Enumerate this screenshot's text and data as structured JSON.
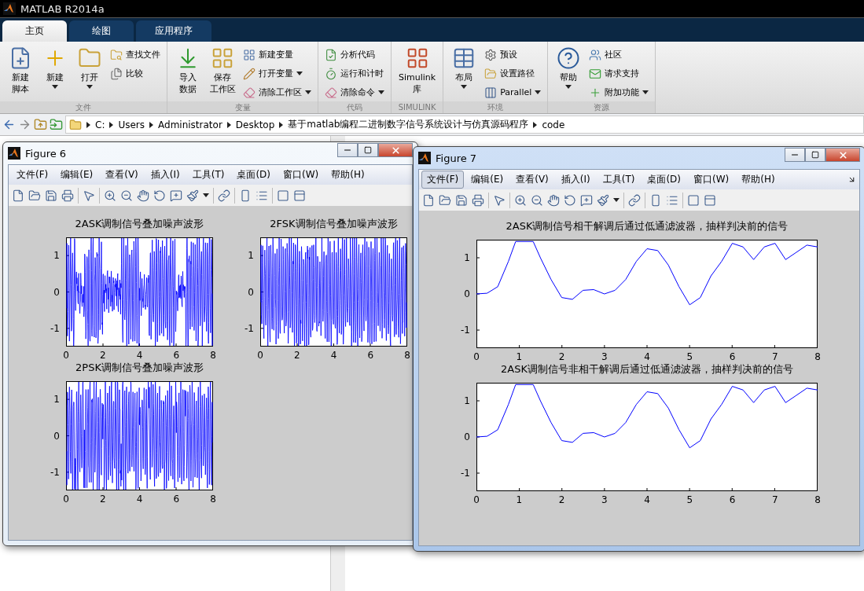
{
  "app": {
    "title": "MATLAB R2014a"
  },
  "tabs": [
    {
      "label": "主页",
      "selected": true
    },
    {
      "label": "绘图",
      "selected": false
    },
    {
      "label": "应用程序",
      "selected": false
    }
  ],
  "toolstrip": [
    {
      "label": "文件",
      "items": [
        {
          "kind": "large",
          "lines": [
            "新建",
            "脚本"
          ],
          "dropdown": false
        },
        {
          "kind": "large",
          "lines": [
            "新建"
          ],
          "dropdown": true
        },
        {
          "kind": "large",
          "lines": [
            "打开"
          ],
          "dropdown": true
        },
        {
          "kind": "small",
          "label": "查找文件",
          "dropdown": false
        },
        {
          "kind": "small",
          "label": "比较",
          "dropdown": false
        }
      ]
    },
    {
      "label": "变量",
      "items": [
        {
          "kind": "large",
          "lines": [
            "导入",
            "数据"
          ],
          "dropdown": false
        },
        {
          "kind": "large",
          "lines": [
            "保存",
            "工作区"
          ],
          "dropdown": false
        },
        {
          "kind": "small",
          "label": "新建变量",
          "dropdown": false
        },
        {
          "kind": "small",
          "label": "打开变量",
          "dropdown": true
        },
        {
          "kind": "small",
          "label": "清除工作区",
          "dropdown": true
        }
      ]
    },
    {
      "label": "代码",
      "items": [
        {
          "kind": "small",
          "label": "分析代码",
          "dropdown": false
        },
        {
          "kind": "small",
          "label": "运行和计时",
          "dropdown": false
        },
        {
          "kind": "small",
          "label": "清除命令",
          "dropdown": true
        }
      ]
    },
    {
      "label": "SIMULINK",
      "items": [
        {
          "kind": "large",
          "lines": [
            "Simulink",
            "库"
          ],
          "dropdown": false
        }
      ]
    },
    {
      "label": "环境",
      "items": [
        {
          "kind": "large",
          "lines": [
            "布局"
          ],
          "dropdown": true
        },
        {
          "kind": "small",
          "label": "预设",
          "dropdown": false
        },
        {
          "kind": "small",
          "label": "设置路径",
          "dropdown": false
        },
        {
          "kind": "small",
          "label": "Parallel",
          "dropdown": true
        }
      ]
    },
    {
      "label": "资源",
      "items": [
        {
          "kind": "large",
          "lines": [
            "帮助"
          ],
          "dropdown": true
        },
        {
          "kind": "small",
          "label": "社区",
          "dropdown": false
        },
        {
          "kind": "small",
          "label": "请求支持",
          "dropdown": false
        },
        {
          "kind": "small",
          "label": "附加功能",
          "dropdown": true
        }
      ]
    }
  ],
  "address_bar": {
    "path": [
      "C:",
      "Users",
      "Administrator",
      "Desktop",
      "基于matlab编程二进制数字信号系统设计与仿真源码程序",
      "code"
    ]
  },
  "figures": [
    {
      "title": "Figure 6",
      "active": false,
      "menu": [
        {
          "label": "文件(F)",
          "selected": false
        },
        {
          "label": "编辑(E)",
          "selected": false
        },
        {
          "label": "查看(V)",
          "selected": false
        },
        {
          "label": "插入(I)",
          "selected": false
        },
        {
          "label": "工具(T)",
          "selected": false
        },
        {
          "label": "桌面(D)",
          "selected": false
        },
        {
          "label": "窗口(W)",
          "selected": false
        },
        {
          "label": "帮助(H)",
          "selected": false
        }
      ],
      "axes": [
        {
          "kind": "waveform",
          "title": "2ASK调制信号叠加噪声波形",
          "xticks": [
            "0",
            "2",
            "4",
            "6",
            "8"
          ],
          "yticks": [
            "1",
            "0",
            "-1"
          ]
        },
        {
          "kind": "waveform",
          "title": "2FSK调制信号叠加噪声波形",
          "xticks": [
            "0",
            "2",
            "4",
            "6",
            "8"
          ],
          "yticks": [
            "1",
            "0",
            "-1"
          ]
        },
        {
          "kind": "waveform",
          "title": "2PSK调制信号叠加噪声波形",
          "xticks": [
            "0",
            "2",
            "4",
            "6",
            "8"
          ],
          "yticks": [
            "1",
            "0",
            "-1"
          ]
        }
      ]
    },
    {
      "title": "Figure 7",
      "active": true,
      "menu": [
        {
          "label": "文件(F)",
          "selected": true
        },
        {
          "label": "编辑(E)",
          "selected": false
        },
        {
          "label": "查看(V)",
          "selected": false
        },
        {
          "label": "插入(I)",
          "selected": false
        },
        {
          "label": "工具(T)",
          "selected": false
        },
        {
          "label": "桌面(D)",
          "selected": false
        },
        {
          "label": "窗口(W)",
          "selected": false
        },
        {
          "label": "帮助(H)",
          "selected": false
        }
      ],
      "axes": [
        {
          "kind": "chart",
          "chart_data": {
            "type": "line",
            "title": "2ASK调制信号相干解调后通过低通滤波器，抽样判决前的信号",
            "x": [
              0,
              0.25,
              0.5,
              0.75,
              0.92,
              1.33,
              1.5,
              1.75,
              2,
              2.25,
              2.5,
              2.75,
              3,
              3.25,
              3.5,
              3.75,
              4,
              4.25,
              4.5,
              4.75,
              5,
              5.25,
              5.5,
              5.75,
              6,
              6.25,
              6.5,
              6.75,
              7,
              7.25,
              7.5,
              7.75,
              8
            ],
            "series": [
              {
                "color": "#0000ff",
                "values": [
                  0,
                  0.02,
                  0.2,
                  0.9,
                  1.45,
                  1.45,
                  1.0,
                  0.4,
                  -0.1,
                  -0.15,
                  0.1,
                  0.12,
                  0.0,
                  0.1,
                  0.4,
                  0.9,
                  1.25,
                  1.2,
                  0.8,
                  0.2,
                  -0.3,
                  -0.1,
                  0.5,
                  0.9,
                  1.4,
                  1.3,
                  0.95,
                  1.3,
                  1.4,
                  0.95,
                  1.15,
                  1.35,
                  1.3
                ]
              }
            ],
            "xlim": [
              0,
              8
            ],
            "ylim": [
              -1.5,
              1.5
            ],
            "xticks": [
              0,
              1,
              2,
              3,
              4,
              5,
              6,
              7,
              8
            ],
            "yticks": [
              1,
              0,
              -1
            ]
          }
        },
        {
          "kind": "chart",
          "chart_data": {
            "type": "line",
            "title": "2ASK调制信号非相干解调后通过低通滤波器，抽样判决前的信号",
            "x": [
              0,
              0.25,
              0.5,
              0.75,
              0.92,
              1.33,
              1.5,
              1.75,
              2,
              2.25,
              2.5,
              2.75,
              3,
              3.25,
              3.5,
              3.75,
              4,
              4.25,
              4.5,
              4.75,
              5,
              5.25,
              5.5,
              5.75,
              6,
              6.25,
              6.5,
              6.75,
              7,
              7.25,
              7.5,
              7.75,
              8
            ],
            "series": [
              {
                "color": "#0000ff",
                "values": [
                  0,
                  0.02,
                  0.2,
                  0.9,
                  1.45,
                  1.45,
                  1.0,
                  0.4,
                  -0.1,
                  -0.15,
                  0.1,
                  0.12,
                  0.0,
                  0.1,
                  0.4,
                  0.9,
                  1.25,
                  1.2,
                  0.8,
                  0.2,
                  -0.3,
                  -0.1,
                  0.5,
                  0.9,
                  1.4,
                  1.3,
                  0.95,
                  1.3,
                  1.4,
                  0.95,
                  1.15,
                  1.35,
                  1.3
                ]
              }
            ],
            "xlim": [
              0,
              8
            ],
            "ylim": [
              -1.5,
              1.5
            ],
            "xticks": [
              0,
              1,
              2,
              3,
              4,
              5,
              6,
              7,
              8
            ],
            "yticks": [
              1,
              0,
              -1
            ]
          }
        }
      ]
    }
  ]
}
